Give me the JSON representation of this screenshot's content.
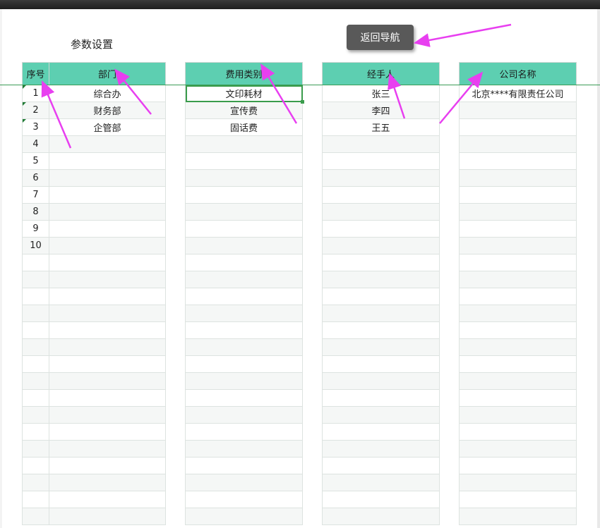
{
  "page": {
    "title": "参数设置"
  },
  "nav": {
    "back_label": "返回导航"
  },
  "tables": {
    "dept": {
      "headers": [
        "序号",
        "部门"
      ],
      "rows": [
        [
          "1",
          "综合办"
        ],
        [
          "2",
          "财务部"
        ],
        [
          "3",
          "企管部"
        ],
        [
          "4",
          ""
        ],
        [
          "5",
          ""
        ],
        [
          "6",
          ""
        ],
        [
          "7",
          ""
        ],
        [
          "8",
          ""
        ],
        [
          "9",
          ""
        ],
        [
          "10",
          ""
        ]
      ]
    },
    "expense": {
      "header": "费用类别",
      "rows": [
        "文印耗材",
        "宣传费",
        "固话费"
      ]
    },
    "handler": {
      "header": "经手人",
      "rows": [
        "张三",
        "李四",
        "王五"
      ]
    },
    "company": {
      "header": "公司名称",
      "rows": [
        "北京****有限责任公司"
      ]
    }
  },
  "total_rows": 26,
  "colors": {
    "header_bg": "#5dcfb1",
    "arrow": "#e83ff0",
    "selection": "#3a9c4c"
  }
}
